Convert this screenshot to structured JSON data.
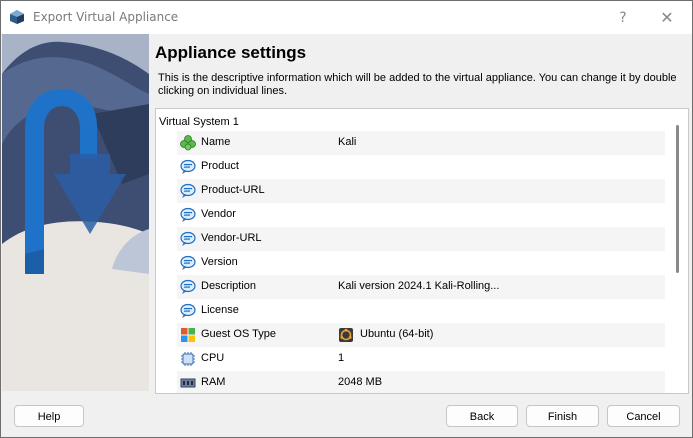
{
  "window": {
    "title": "Export Virtual Appliance",
    "help_glyph": "?",
    "close_glyph": "✕"
  },
  "page": {
    "heading": "Appliance settings",
    "description": "This is the descriptive information which will be added to the virtual appliance. You can change it by double clicking on individual lines."
  },
  "tree": {
    "group": "Virtual System 1",
    "rows": [
      {
        "label": "Name",
        "value": "Kali",
        "icon": "name-icon"
      },
      {
        "label": "Product",
        "value": "",
        "icon": "speech-bubble-icon"
      },
      {
        "label": "Product-URL",
        "value": "",
        "icon": "speech-bubble-icon"
      },
      {
        "label": "Vendor",
        "value": "",
        "icon": "speech-bubble-icon"
      },
      {
        "label": "Vendor-URL",
        "value": "",
        "icon": "speech-bubble-icon"
      },
      {
        "label": "Version",
        "value": "",
        "icon": "speech-bubble-icon"
      },
      {
        "label": "Description",
        "value": "Kali version 2024.1 Kali-Rolling...",
        "icon": "speech-bubble-icon"
      },
      {
        "label": "License",
        "value": "",
        "icon": "speech-bubble-icon"
      },
      {
        "label": "Guest OS Type",
        "value": "Ubuntu (64-bit)",
        "icon": "os-type-icon",
        "value_icon": "ubuntu-icon"
      },
      {
        "label": "CPU",
        "value": "1",
        "icon": "cpu-icon"
      },
      {
        "label": "RAM",
        "value": "2048 MB",
        "icon": "ram-icon"
      }
    ]
  },
  "buttons": {
    "help": "Help",
    "back": "Back",
    "finish": "Finish",
    "cancel": "Cancel"
  }
}
